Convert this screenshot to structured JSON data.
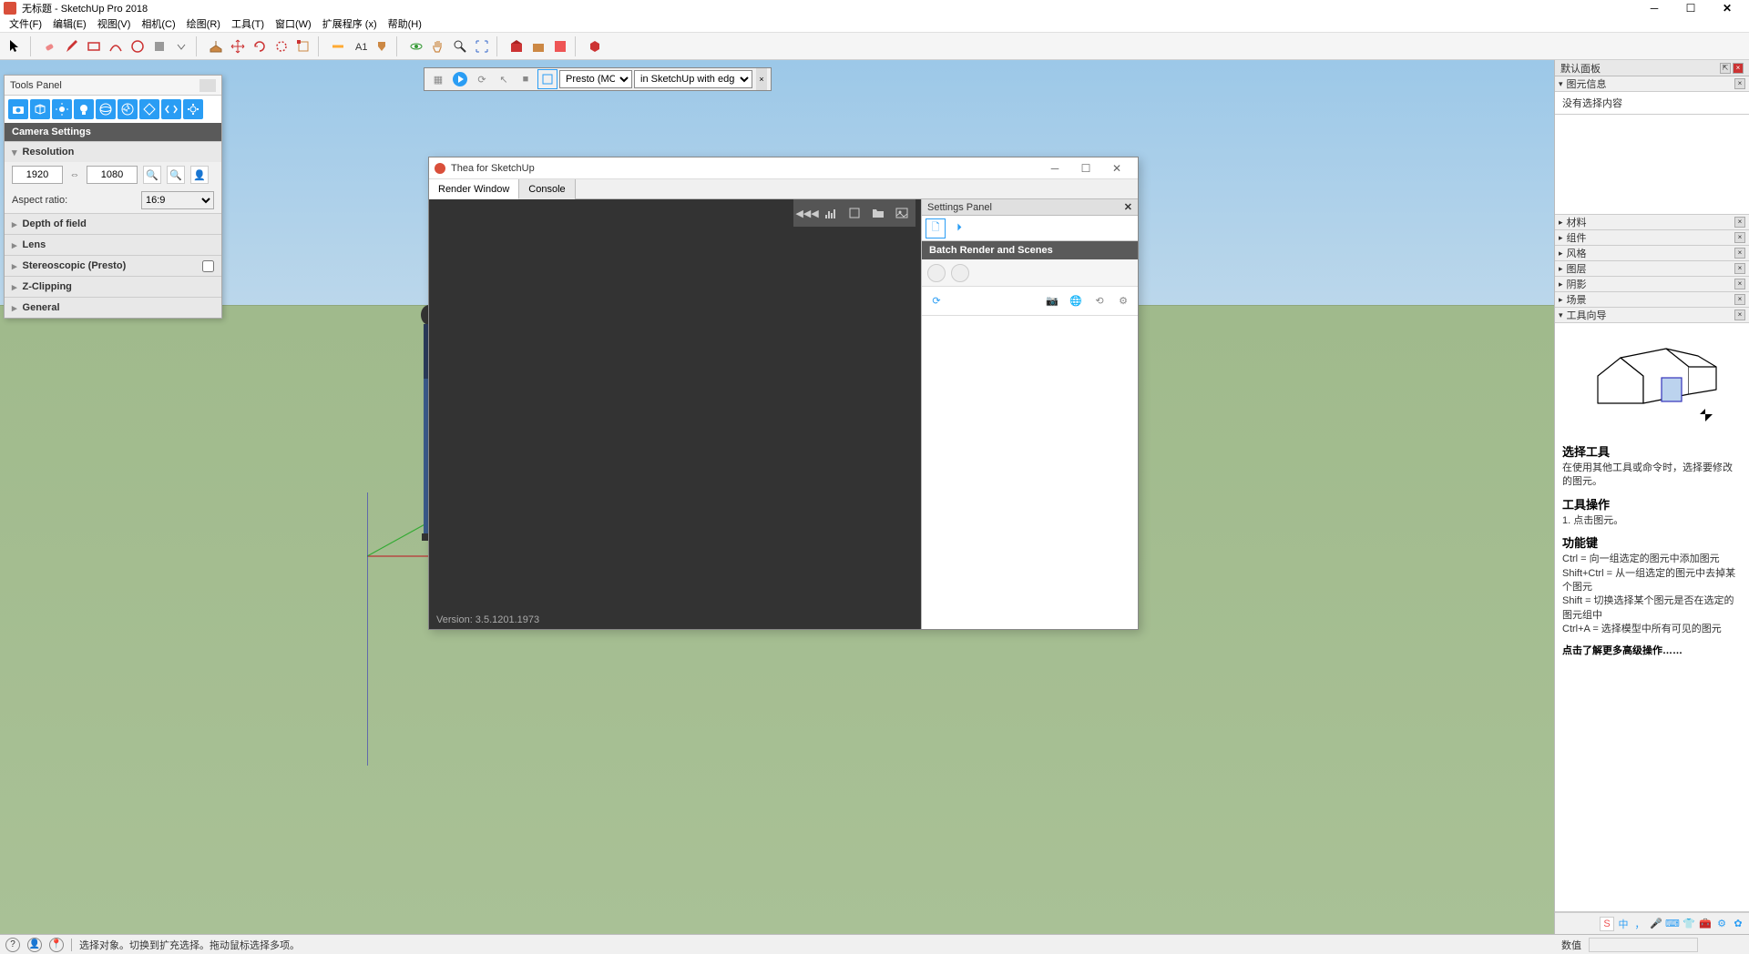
{
  "app": {
    "title": "无标题 - SketchUp Pro 2018"
  },
  "menu": {
    "items": [
      "文件(F)",
      "编辑(E)",
      "视图(V)",
      "相机(C)",
      "绘图(R)",
      "工具(T)",
      "窗口(W)",
      "扩展程序 (x)",
      "帮助(H)"
    ]
  },
  "tools_panel": {
    "title": "Tools Panel",
    "camera_settings": "Camera Settings",
    "resolution_label": "Resolution",
    "width": "1920",
    "height": "1080",
    "aspect_label": "Aspect ratio:",
    "aspect_value": "16:9",
    "sections": [
      "Depth of field",
      "Lens",
      "Stereoscopic (Presto)",
      "Z-Clipping",
      "General"
    ]
  },
  "render_toolbar": {
    "preset": "Presto (MC)",
    "mode": "in SketchUp with edges"
  },
  "thea": {
    "title": "Thea for SketchUp",
    "tabs": [
      "Render Window",
      "Console"
    ],
    "settings_title": "Settings Panel",
    "batch_header": "Batch Render and Scenes",
    "version": "Version: 3.5.1201.1973"
  },
  "right_tray": {
    "title": "默认面板",
    "entity_info": "图元信息",
    "no_selection": "没有选择内容",
    "sections": [
      "材料",
      "组件",
      "风格",
      "图层",
      "阴影",
      "场景",
      "工具向导"
    ],
    "instructor": {
      "tool_title": "选择工具",
      "tool_desc": "在使用其他工具或命令时，选择要修改的图元。",
      "ops_title": "工具操作",
      "ops_1": "1. 点击图元。",
      "keys_title": "功能键",
      "key_ctrl": "Ctrl = 向一组选定的图元中添加图元",
      "key_shift_ctrl": "Shift+Ctrl = 从一组选定的图元中去掉某个图元",
      "key_shift": "Shift = 切换选择某个图元是否在选定的图元组中",
      "key_ctrl_a": "Ctrl+A = 选择模型中所有可见的图元",
      "more_link": "点击了解更多高级操作……"
    }
  },
  "statusbar": {
    "message": "选择对象。切换到扩充选择。拖动鼠标选择多项。",
    "value_label": "数值"
  }
}
